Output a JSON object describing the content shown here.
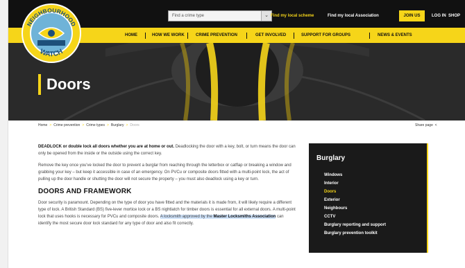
{
  "top_bar": {
    "crime_select": {
      "value": "Find a crime type"
    },
    "links": {
      "local_scheme": "Find my local scheme",
      "local_association": "Find my local Association",
      "join": "JOIN US",
      "login": "LOG IN",
      "shop": "SHOP"
    }
  },
  "logo": {
    "text_top": "NEIGHBOURHOOD",
    "text_bottom": "WATCH"
  },
  "nav": {
    "items": [
      "HOME",
      "HOW WE WORK",
      "CRIME PREVENTION",
      "GET INVOLVED",
      "SUPPORT FOR GROUPS",
      "NEWS & EVENTS"
    ]
  },
  "hero": {
    "title": "Doors"
  },
  "breadcrumb": {
    "items": [
      "Home",
      "Crime prevention",
      "Crime types",
      "Burglary",
      "Doors"
    ]
  },
  "share": {
    "label": "Share page"
  },
  "content": {
    "intro_bold": "DEADLOCK or double lock all doors whether you are at home or out.",
    "intro_rest": " Deadlocking the door with a key, bolt, or turn means the door can only be opened from the inside or the outside using the correct key.",
    "para2": "Remove the key once you've locked the door to prevent a burglar from reaching through the letterbox or catflap or breaking a window and grabbing your key – but keep it accessible in case of an emergency. On PVCu or composite doors fitted with a multi-point lock, the act of pulling up the door handle or shutting the door will not secure the property – you must also deadlock using a key or turn.",
    "heading": "DOORS AND FRAMEWORK",
    "para3_start": "Door security is paramount. Depending on the type of door you have fitted and the materials it is made from, it will likely require a different type of lock. A British Standard (BS) five-lever mortice lock or a BS nightlatch for timber doors is essential for all external doors. A multi-point lock that uses hooks is necessary for PVCu and composite doors. ",
    "para3_highlight": "A locksmith approved by the ",
    "para3_highlight_bold": "Master Locksmiths Association",
    "para3_end": " can identify the most secure door lock standard for any type of door and also fit correctly."
  },
  "sidebar": {
    "title": "Burglary",
    "items": [
      "Windows",
      "Interior",
      "Doors",
      "Exterior",
      "Neighbours",
      "CCTV",
      "Burglary reporting and support",
      "Burglary prevention toolkit"
    ],
    "active": "Doors"
  },
  "colors": {
    "brand_yellow": "#f6d519",
    "top_bar": "#111111",
    "sidebar_bg": "#1a1a1a",
    "highlight": "#cfe3fb"
  }
}
